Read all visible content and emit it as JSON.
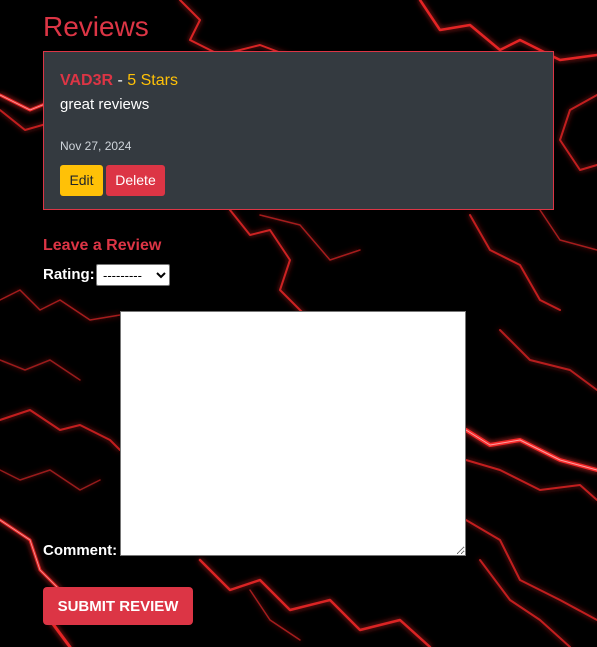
{
  "page": {
    "title": "Reviews"
  },
  "review": {
    "author": "VAD3R",
    "separator": " - ",
    "stars": "5 Stars",
    "text": "great reviews",
    "date": "Nov 27, 2024",
    "edit_label": "Edit",
    "delete_label": "Delete"
  },
  "form": {
    "heading": "Leave a Review",
    "rating_label": "Rating:",
    "rating_selected": "---------",
    "comment_label": "Comment:",
    "comment_value": "",
    "submit_label": "SUBMIT REVIEW"
  },
  "colors": {
    "accent": "#dc3545",
    "stars": "#ffc107",
    "card_bg": "#343a40",
    "background": "#000000"
  }
}
